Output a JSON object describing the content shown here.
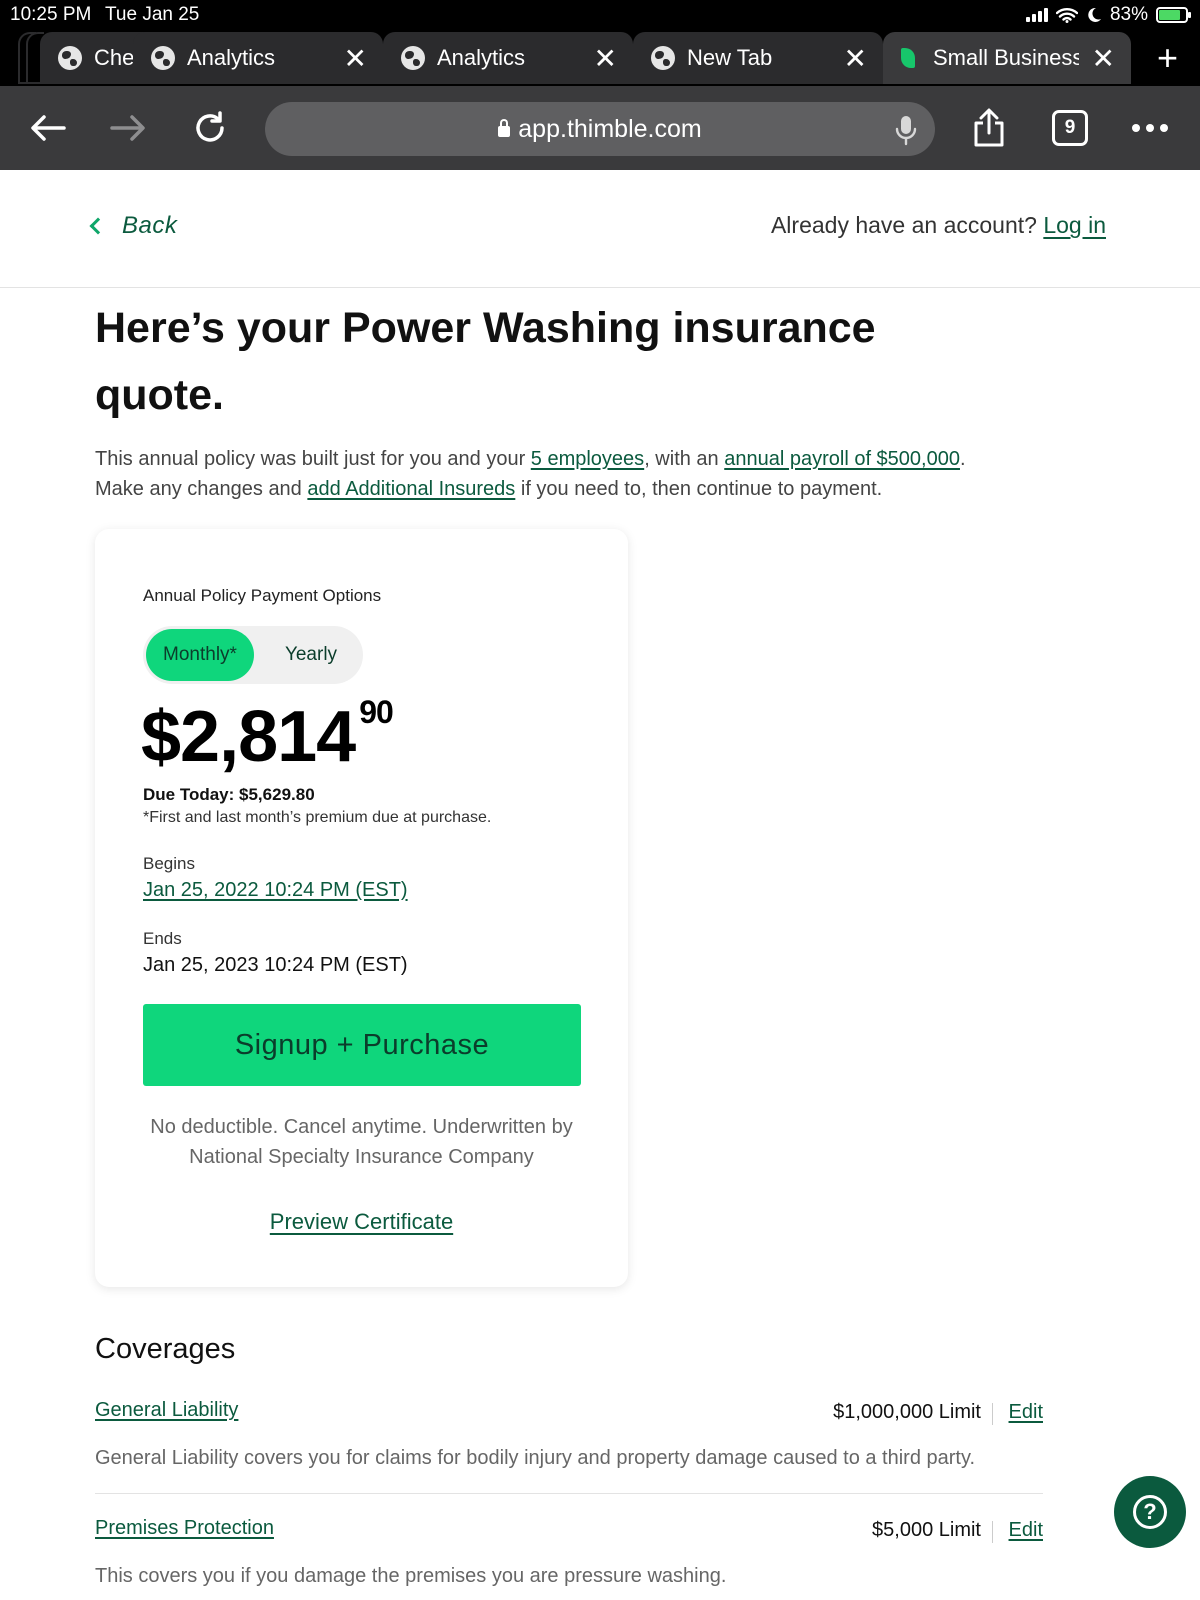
{
  "status_bar": {
    "time": "10:25 PM",
    "date": "Tue Jan 25",
    "battery": "83%"
  },
  "tabs": [
    {
      "title": "Che",
      "icon": "globe-icon"
    },
    {
      "title": "Analytics",
      "icon": "globe-icon"
    },
    {
      "title": "Analytics",
      "icon": "globe-icon"
    },
    {
      "title": "New Tab",
      "icon": "globe-icon"
    },
    {
      "title": "Small Business",
      "icon": "thimble-favicon",
      "active": true
    }
  ],
  "toolbar": {
    "url": "app.thimble.com",
    "tab_count": "9"
  },
  "header": {
    "back_label": "Back",
    "account_prompt": "Already have an account?",
    "login_label": "Log in"
  },
  "main": {
    "title": "Here’s your Power Washing insurance quote.",
    "intro": {
      "part1": "This annual policy was built just for you and your ",
      "employees_link": "5 employees",
      "part2": ", with an ",
      "payroll_link": "annual payroll of $500,000",
      "part3": ".",
      "part4": "Make any changes and ",
      "insureds_link": "add Additional Insureds",
      "part5": " if you need to, then continue to payment."
    }
  },
  "quote_card": {
    "options_label": "Annual Policy Payment Options",
    "toggle": {
      "monthly": "Monthly*",
      "yearly": "Yearly",
      "selected": "Monthly*"
    },
    "price_main": "$2,814",
    "price_cents": "90",
    "due_today": "Due Today: $5,629.80",
    "due_note": "*First and last month’s premium due at purchase.",
    "begins_label": "Begins",
    "begins_value": "Jan 25, 2022 10:24 PM (EST)",
    "ends_label": "Ends",
    "ends_value": "Jan 25, 2023 10:24 PM (EST)",
    "cta_label": "Signup + Purchase",
    "fine_print": "No deductible. Cancel anytime. Underwritten by National Specialty Insurance Company",
    "preview_label": "Preview Certificate"
  },
  "coverages": {
    "heading": "Coverages",
    "items": [
      {
        "name": "General Liability",
        "limit": "$1,000,000 Limit",
        "edit": "Edit",
        "description": "General Liability covers you for claims for bodily injury and property damage caused to a third party."
      },
      {
        "name": "Premises Protection",
        "limit": "$5,000 Limit",
        "edit": "Edit",
        "description": "This covers you if you damage the premises you are pressure washing."
      }
    ]
  },
  "colors": {
    "brand_green": "#0fd67c",
    "link_green": "#0b5a3e",
    "browser_dark": "#3a3a3c"
  }
}
